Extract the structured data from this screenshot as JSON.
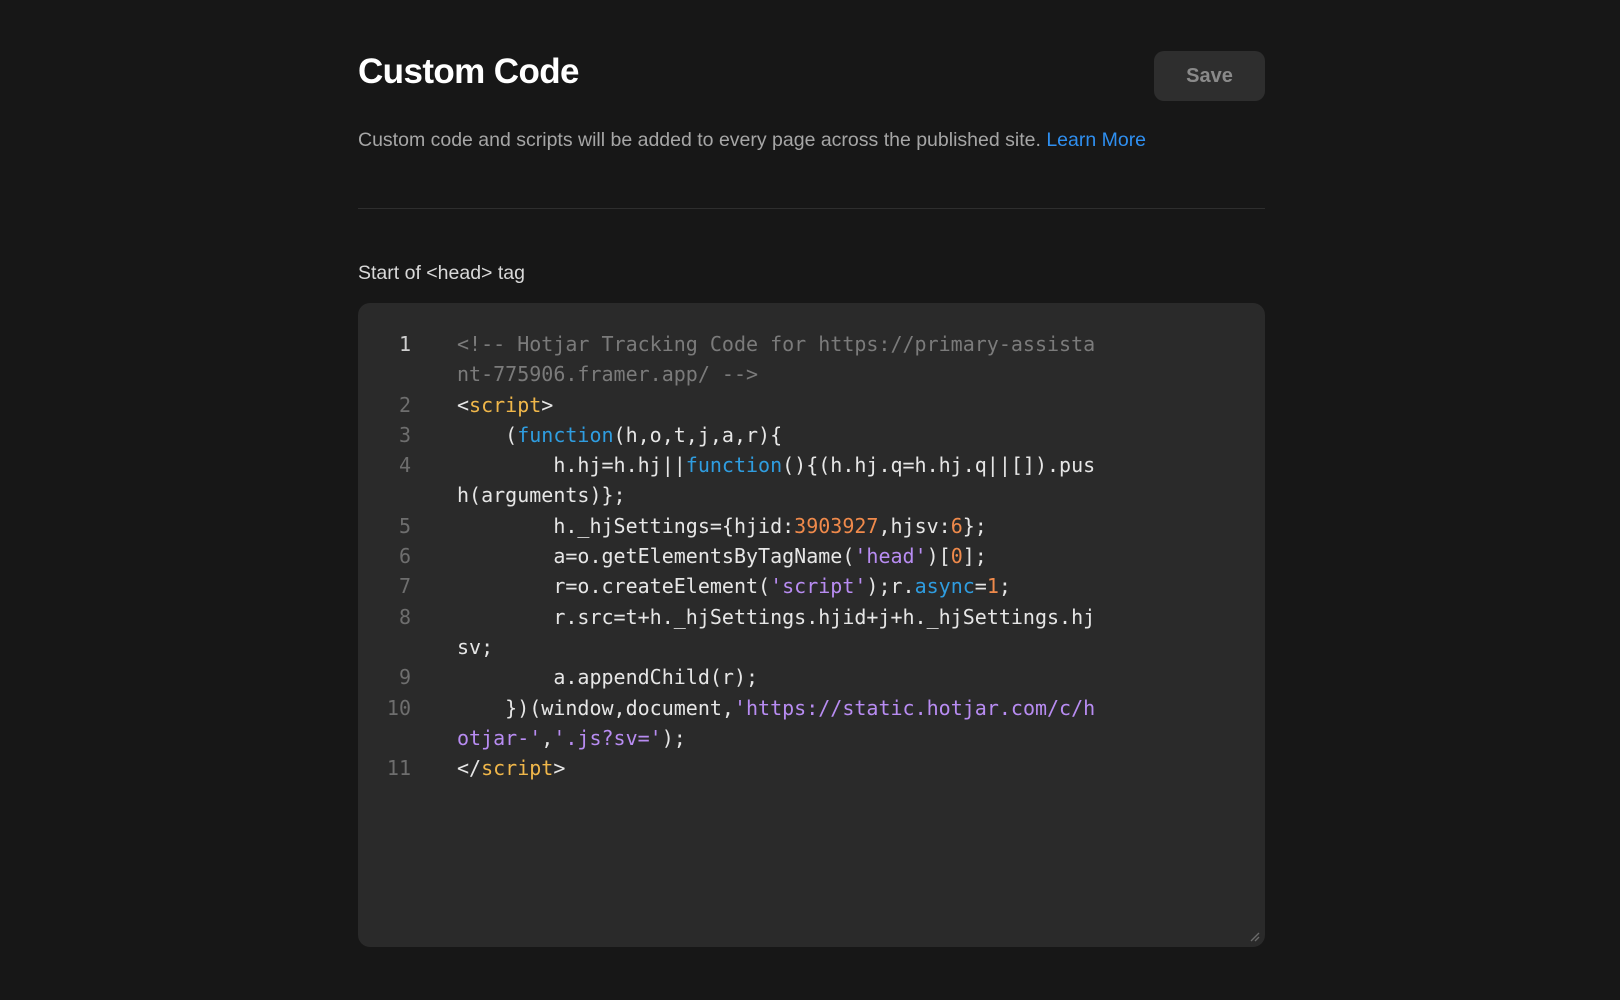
{
  "header": {
    "title": "Custom Code",
    "save_label": "Save"
  },
  "description": {
    "text": "Custom code and scripts will be added to every page across the published site. ",
    "link_label": "Learn More"
  },
  "section": {
    "label": "Start of <head> tag"
  },
  "colors": {
    "background": "#171717",
    "editor_background": "#2a2a2a",
    "link": "#2f8ff0",
    "comment": "#7b7b7b",
    "tag": "#f0b74a",
    "keyword": "#2f9de0",
    "number": "#f08a4b",
    "string": "#b88cf2"
  },
  "editor": {
    "active_line": 1,
    "lines": [
      {
        "number": "1",
        "tokens": [
          {
            "t": "comment",
            "v": "<!-- Hotjar Tracking Code for https://primary-assistant-775906.framer.app/ -->"
          }
        ]
      },
      {
        "number": "2",
        "tokens": [
          {
            "t": "plain",
            "v": "<"
          },
          {
            "t": "tag",
            "v": "script"
          },
          {
            "t": "plain",
            "v": ">"
          }
        ]
      },
      {
        "number": "3",
        "tokens": [
          {
            "t": "plain",
            "v": "    ("
          },
          {
            "t": "keyword",
            "v": "function"
          },
          {
            "t": "plain",
            "v": "(h,o,t,j,a,r){"
          }
        ]
      },
      {
        "number": "4",
        "tokens": [
          {
            "t": "plain",
            "v": "        h.hj=h.hj||"
          },
          {
            "t": "keyword",
            "v": "function"
          },
          {
            "t": "plain",
            "v": "(){(h.hj.q=h.hj.q||[]).push(arguments)};"
          }
        ]
      },
      {
        "number": "5",
        "tokens": [
          {
            "t": "plain",
            "v": "        h._hjSettings={hjid:"
          },
          {
            "t": "number",
            "v": "3903927"
          },
          {
            "t": "plain",
            "v": ",hjsv:"
          },
          {
            "t": "number",
            "v": "6"
          },
          {
            "t": "plain",
            "v": "};"
          }
        ]
      },
      {
        "number": "6",
        "tokens": [
          {
            "t": "plain",
            "v": "        a=o.getElementsByTagName("
          },
          {
            "t": "string",
            "v": "'head'"
          },
          {
            "t": "plain",
            "v": ")["
          },
          {
            "t": "number",
            "v": "0"
          },
          {
            "t": "plain",
            "v": "];"
          }
        ]
      },
      {
        "number": "7",
        "tokens": [
          {
            "t": "plain",
            "v": "        r=o.createElement("
          },
          {
            "t": "string",
            "v": "'script'"
          },
          {
            "t": "plain",
            "v": ");r."
          },
          {
            "t": "keyword",
            "v": "async"
          },
          {
            "t": "plain",
            "v": "="
          },
          {
            "t": "number",
            "v": "1"
          },
          {
            "t": "plain",
            "v": ";"
          }
        ]
      },
      {
        "number": "8",
        "tokens": [
          {
            "t": "plain",
            "v": "        r.src=t+h._hjSettings.hjid+j+h._hjSettings.hjsv;"
          }
        ]
      },
      {
        "number": "9",
        "tokens": [
          {
            "t": "plain",
            "v": "        a.appendChild(r);"
          }
        ]
      },
      {
        "number": "10",
        "tokens": [
          {
            "t": "plain",
            "v": "    })(window,document,"
          },
          {
            "t": "string",
            "v": "'https://static.hotjar.com/c/hotjar-'"
          },
          {
            "t": "plain",
            "v": ","
          },
          {
            "t": "string",
            "v": "'.js?sv='"
          },
          {
            "t": "plain",
            "v": ");"
          }
        ]
      },
      {
        "number": "11",
        "tokens": [
          {
            "t": "plain",
            "v": "</"
          },
          {
            "t": "tag",
            "v": "script"
          },
          {
            "t": "plain",
            "v": ">"
          }
        ]
      }
    ]
  }
}
